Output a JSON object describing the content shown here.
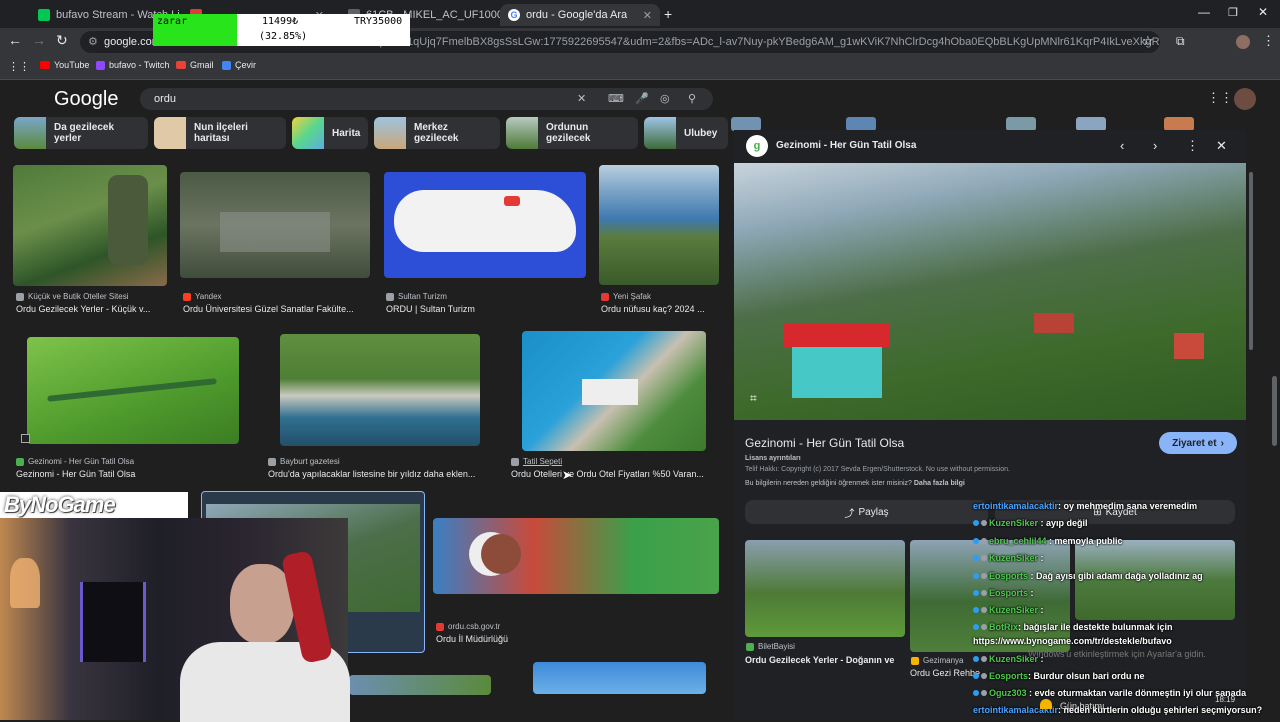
{
  "browser": {
    "tabs": [
      {
        "label": "bufavo Stream - Watch Live o",
        "color": "#00c853"
      },
      {
        "label": "",
        "color": "#e53935"
      },
      {
        "label": "61CB - MIKEL_AC_UF1000,1000",
        "color": "#5f6368"
      },
      {
        "label": "ordu - Google'da Ara",
        "color": "#4285f4"
      }
    ],
    "url": "google.com/search?...qfSO21qUjq7FmelbBX8gsSsLGw:1775922695547&udm=2&fbs=ADc_l-av7Nuy-pkYBedg6AM_g1wKViK7NhClrDcg4hOba0EQbBLKgUpMNlr61KqrP4IkLveXkgRRLMovjWx67fHkq-I...",
    "url_prefix": "google.com",
    "url_rest": "qfSO21qUjq7FmelbBX8gsSsLGw:1775922695547&udm=2&fbs=ADc_l-av7Nuy-pkYBedg6AM_g1wKViK7NhClrDcg4hOba0EQbBLKgUpMNlr61KqrP4IkLveXkgRRLMovjWx67fHkq-I...",
    "bookmarks": [
      "YouTube",
      "bufavo - Twitch",
      "Gmail",
      "Çevir"
    ]
  },
  "overlay": {
    "label": "zarar",
    "amount": "11499₺",
    "percent": "(32.85%)",
    "total": "TRY35000"
  },
  "google": {
    "logo": "Google",
    "query": "ordu",
    "chips": [
      "Da gezilecek yerler",
      "Nun ilçeleri haritası",
      "Harita",
      "Merkez gezilecek",
      "Ordunun gezilecek",
      "Ulubey"
    ]
  },
  "results": [
    {
      "source": "Küçük ve Butik Oteller Sitesi",
      "title": "Ordu Gezilecek Yerler - Küçük v..."
    },
    {
      "source": "Yandex",
      "title": "Ordu Üniversitesi Güzel Sanatlar Fakülte..."
    },
    {
      "source": "Sultan Turizm",
      "title": "ORDU | Sultan Turizm"
    },
    {
      "source": "Yeni Şafak",
      "title": "Ordu nüfusu kaç? 2024 ..."
    },
    {
      "source": "Gezinomi - Her Gün Tatil Olsa",
      "title": "Gezinomi - Her Gün Tatil Olsa"
    },
    {
      "source": "Bayburt gazetesi",
      "title": "Ordu'da yapılacaklar listesine bir yıldız daha eklen..."
    },
    {
      "source": "Tatil Sepeti",
      "title": "Ordu Otelleri ve Ordu Otel Fiyatları %50 Varan..."
    },
    {
      "source": "ordu.csb.gov.tr",
      "title": "Ordu İl Müdürlüğü"
    }
  ],
  "panel": {
    "site_name": "Gezinomi - Her Gün Tatil Olsa",
    "title": "Gezinomi - Her Gün Tatil Olsa",
    "visit": "Ziyaret et",
    "license_label": "Lisans ayrıntıları",
    "copyright": "Telif Hakkı: Copyright (c) 2017 Sevda Ergen/Shutterstock. No use without permission.",
    "info_question": "Bu bilgilerin nereden geldiğini öğrenmek ister misiniz?",
    "info_link": "Daha fazla bilgi",
    "share": "Paylaş",
    "save": "Kaydet",
    "related": [
      {
        "source": "BiletBayisi",
        "title": "Ordu Gezilecek Yerler - Doğanın ve..."
      },
      {
        "source": "Gezimanya",
        "title": "Ordu Gezi Rehberi"
      }
    ]
  },
  "stream": {
    "logo": "ByNoGame"
  },
  "chat": [
    {
      "user": "ertointikamalacaktir",
      "msg": ": oy mehmedim sana veremedim"
    },
    {
      "user": "KuzenSiker",
      "msg": ": ayıp değil"
    },
    {
      "user": "ebru_cehlil44",
      "msg": ": memoyla public"
    },
    {
      "user": "KuzenSiker",
      "msg": ":"
    },
    {
      "user": "Eosports",
      "msg": ": Dağ ayısı gibi adamı dağa yolladınız ag"
    },
    {
      "user": "Eosports",
      "msg": ":"
    },
    {
      "user": "KuzenSiker",
      "msg": ":"
    },
    {
      "user": "BotRix",
      "msg": ": bağışlar ile destekte bulunmak için"
    },
    {
      "user": "",
      "msg": "https://www.bynogame.com/tr/destekle/bufavo"
    },
    {
      "user": "KuzenSiker",
      "msg": ":"
    },
    {
      "user": "Eosports",
      "msg": ": Burdur olsun bari ordu ne"
    },
    {
      "user": "Oguz303",
      "msg": ": evde oturmaktan varile dönmeştin iyi olur sanada"
    },
    {
      "user": "ertointikamalacaktir",
      "msg": ": neden kürtlerin olduğu şehirleri seçmiyorsun?"
    }
  ],
  "taskbar": {
    "weather": "Gün batımı",
    "time": "18:19",
    "watermark": "Windows'u etkinleştirmek için Ayarlar'a gidin."
  },
  "colors": {
    "accent": "#8ab4f8",
    "green_overlay": "#27e51a",
    "page_bg": "#1f1f1f"
  }
}
